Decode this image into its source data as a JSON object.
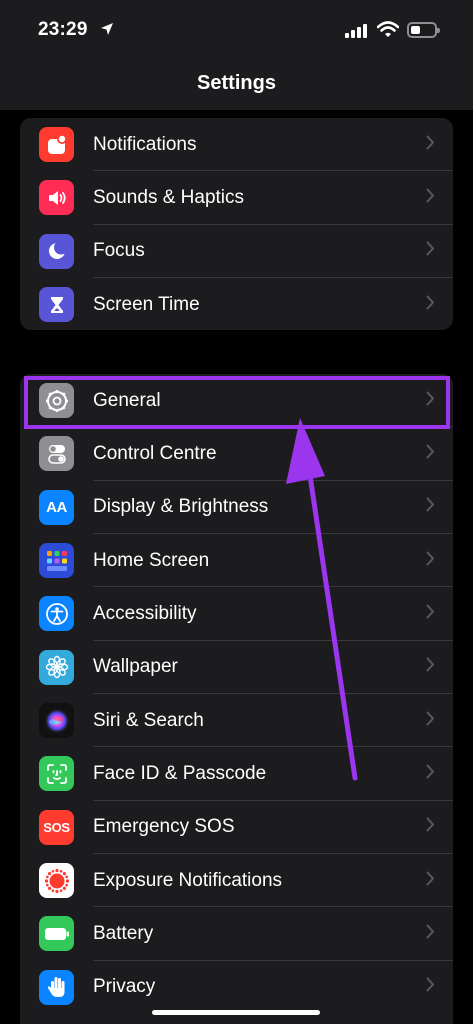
{
  "status_bar": {
    "time": "23:29",
    "icons": [
      "location-arrow-icon",
      "cellular-signal-icon",
      "wifi-icon",
      "battery-icon"
    ]
  },
  "header": {
    "title": "Settings"
  },
  "groups": [
    {
      "items": [
        {
          "label": "Notifications",
          "icon": "notifications-icon",
          "color": "#ff3b30"
        },
        {
          "label": "Sounds & Haptics",
          "icon": "speaker-icon",
          "color": "#ff2d55"
        },
        {
          "label": "Focus",
          "icon": "moon-icon",
          "color": "#5856d6"
        },
        {
          "label": "Screen Time",
          "icon": "hourglass-icon",
          "color": "#5856d6"
        }
      ]
    },
    {
      "items": [
        {
          "label": "General",
          "icon": "gear-icon",
          "color": "#8e8e93",
          "highlighted": true
        },
        {
          "label": "Control Centre",
          "icon": "toggles-icon",
          "color": "#8e8e93"
        },
        {
          "label": "Display & Brightness",
          "icon": "text-size-icon",
          "icon_text": "AA",
          "color": "#0a84ff"
        },
        {
          "label": "Home Screen",
          "icon": "app-grid-icon",
          "color": "#2c4bd6"
        },
        {
          "label": "Accessibility",
          "icon": "accessibility-icon",
          "color": "#0a84ff"
        },
        {
          "label": "Wallpaper",
          "icon": "flower-icon",
          "color": "#34aadc"
        },
        {
          "label": "Siri & Search",
          "icon": "siri-icon",
          "color": "#111111"
        },
        {
          "label": "Face ID & Passcode",
          "icon": "face-id-icon",
          "color": "#34c759"
        },
        {
          "label": "Emergency SOS",
          "icon": "sos-icon",
          "icon_text": "SOS",
          "color": "#ff3b30"
        },
        {
          "label": "Exposure Notifications",
          "icon": "exposure-icon",
          "color": "#ffffff"
        },
        {
          "label": "Battery",
          "icon": "battery-setting-icon",
          "color": "#34c759"
        },
        {
          "label": "Privacy",
          "icon": "hand-icon",
          "color": "#0a84ff"
        }
      ]
    }
  ],
  "annotation": {
    "highlight_color": "#9b35ee"
  }
}
